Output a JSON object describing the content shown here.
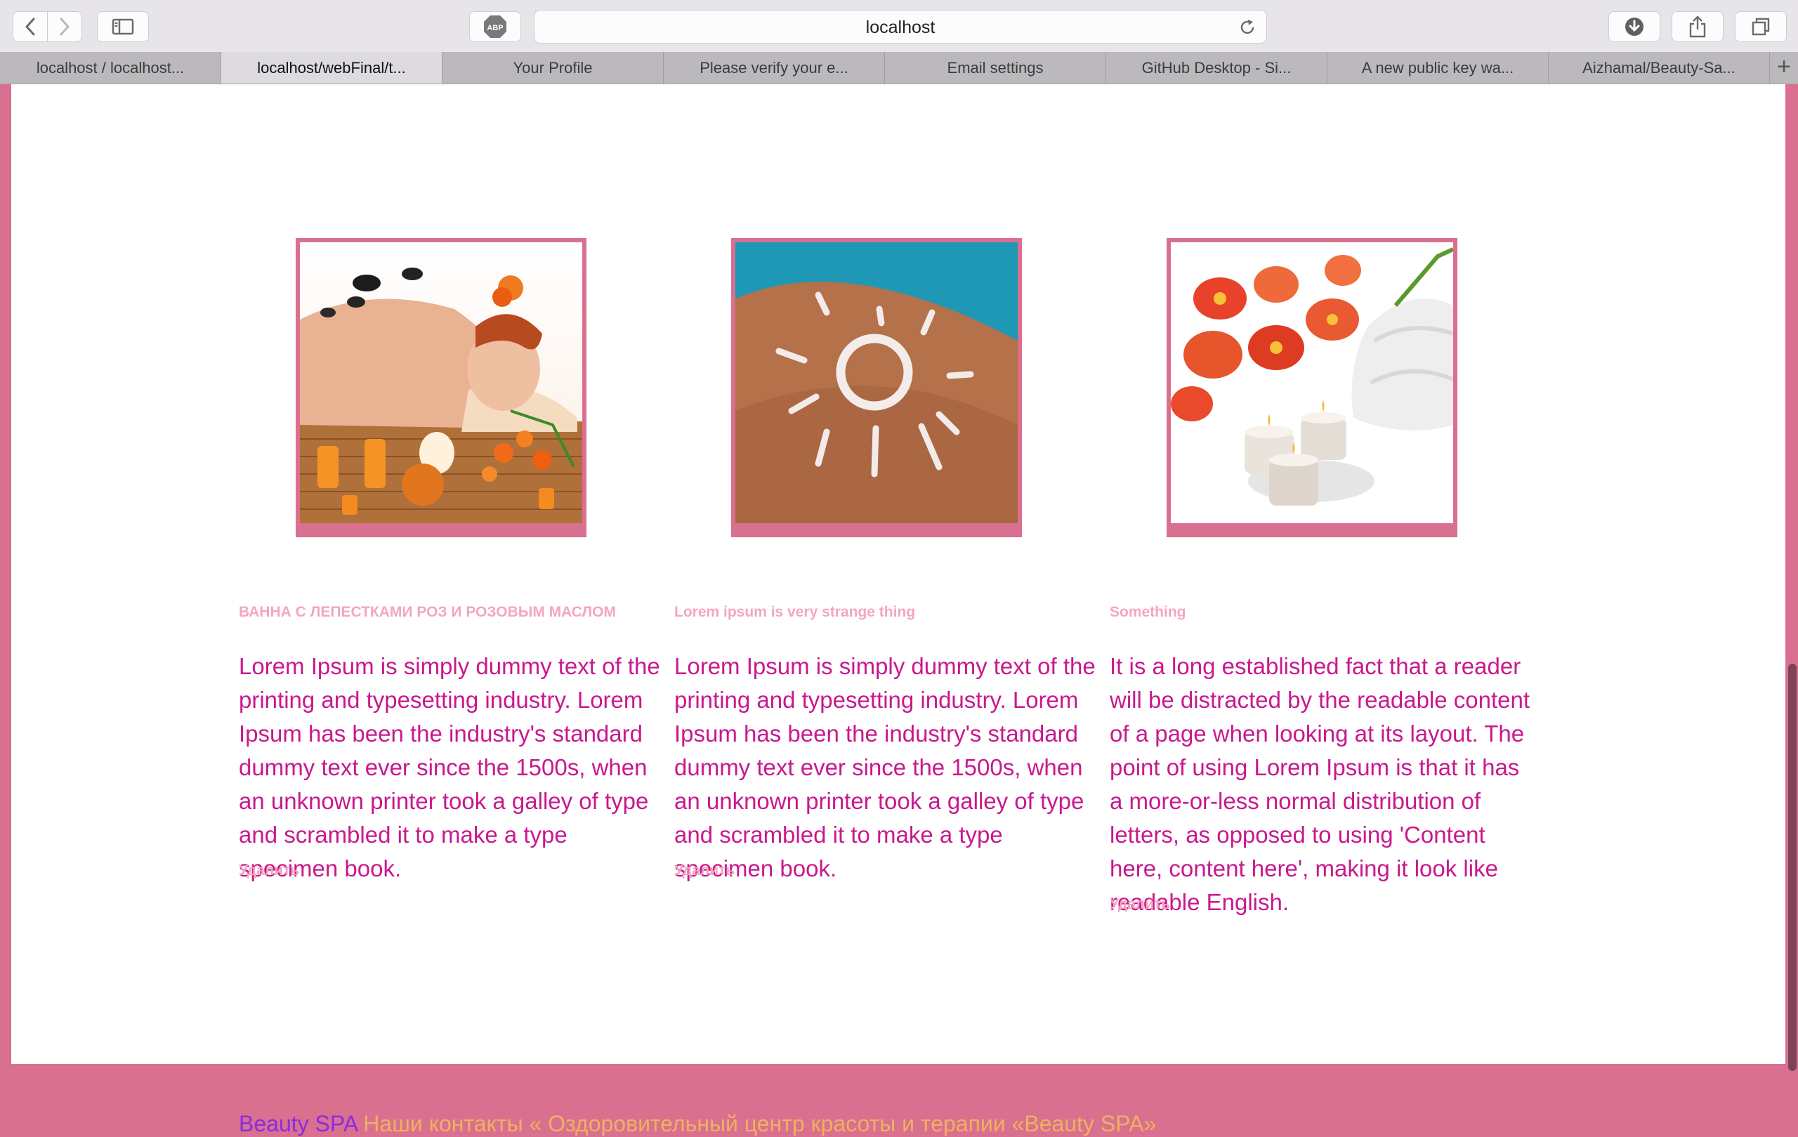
{
  "browser": {
    "url": "localhost",
    "extension_label": "ABP",
    "tabs": [
      {
        "label": "localhost / localhost...",
        "active": false
      },
      {
        "label": "localhost/webFinal/t...",
        "active": true
      },
      {
        "label": "Your Profile",
        "active": false
      },
      {
        "label": "Please verify your e...",
        "active": false
      },
      {
        "label": "Email settings",
        "active": false
      },
      {
        "label": "GitHub Desktop - Si...",
        "active": false
      },
      {
        "label": "A new public key wa...",
        "active": false
      },
      {
        "label": "Aizhamal/Beauty-Sa...",
        "active": false
      }
    ],
    "new_tab_label": "+"
  },
  "cards": [
    {
      "image": "hot-stone-massage-photo",
      "title": "ВАННА С ЛЕПЕСТКАМИ РОЗ И РОЗОВЫМ МАСЛОМ",
      "body": "Lorem Ipsum is simply dummy text of the printing and typesetting industry. Lorem Ipsum has been the industry's standard dummy text ever since the 1500s, when an unknown printer took a galley of type and scrambled it to make a type specimen book.",
      "delete_label": "Удалить"
    },
    {
      "image": "sun-cream-back-photo",
      "title": "Lorem ipsum is very strange thing",
      "body": "Lorem Ipsum is simply dummy text of the printing and typesetting industry. Lorem Ipsum has been the industry's standard dummy text ever since the 1500s, when an unknown printer took a galley of type and scrambled it to make a type specimen book.",
      "delete_label": "Удалить"
    },
    {
      "image": "orchid-candles-photo",
      "title": "Something",
      "body": "It is a long established fact that a reader will be distracted by the readable content of a page when looking at its layout. The point of using Lorem Ipsum is that it has a more-or-less normal distribution of letters, as opposed to using 'Content here, content here', making it look like readable English.",
      "delete_label": "Удалить"
    }
  ],
  "footer": {
    "brand": "Beauty SPA",
    "description": " Наши контакты « Оздоровительный центр красоты и терапии «Beauty SPA»"
  },
  "colors": {
    "page_border": "#d9708f",
    "title_pink": "#f3a6c0",
    "body_magenta": "#c9188e"
  }
}
